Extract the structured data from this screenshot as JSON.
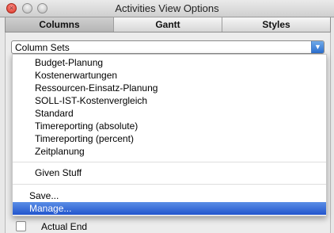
{
  "window": {
    "title": "Activities View Options"
  },
  "tabs": [
    {
      "label": "Columns",
      "active": true
    },
    {
      "label": "Gantt",
      "active": false
    },
    {
      "label": "Styles",
      "active": false
    }
  ],
  "select": {
    "value": "Column Sets",
    "arrow_icon": "chevron-down-icon"
  },
  "menu": {
    "sets": [
      "Budget-Planung",
      "Kostenerwartungen",
      "Ressourcen-Einsatz-Planung",
      "SOLL-IST-Kostenvergleich",
      "Standard",
      "Timereporting (absolute)",
      "Timereporting (percent)",
      "Zeitplanung"
    ],
    "custom": "Given Stuff",
    "save": "Save...",
    "manage": "Manage...",
    "highlight_color": "#2a5fd6"
  },
  "background": {
    "bottom_item": "Actual End",
    "checked": false
  }
}
